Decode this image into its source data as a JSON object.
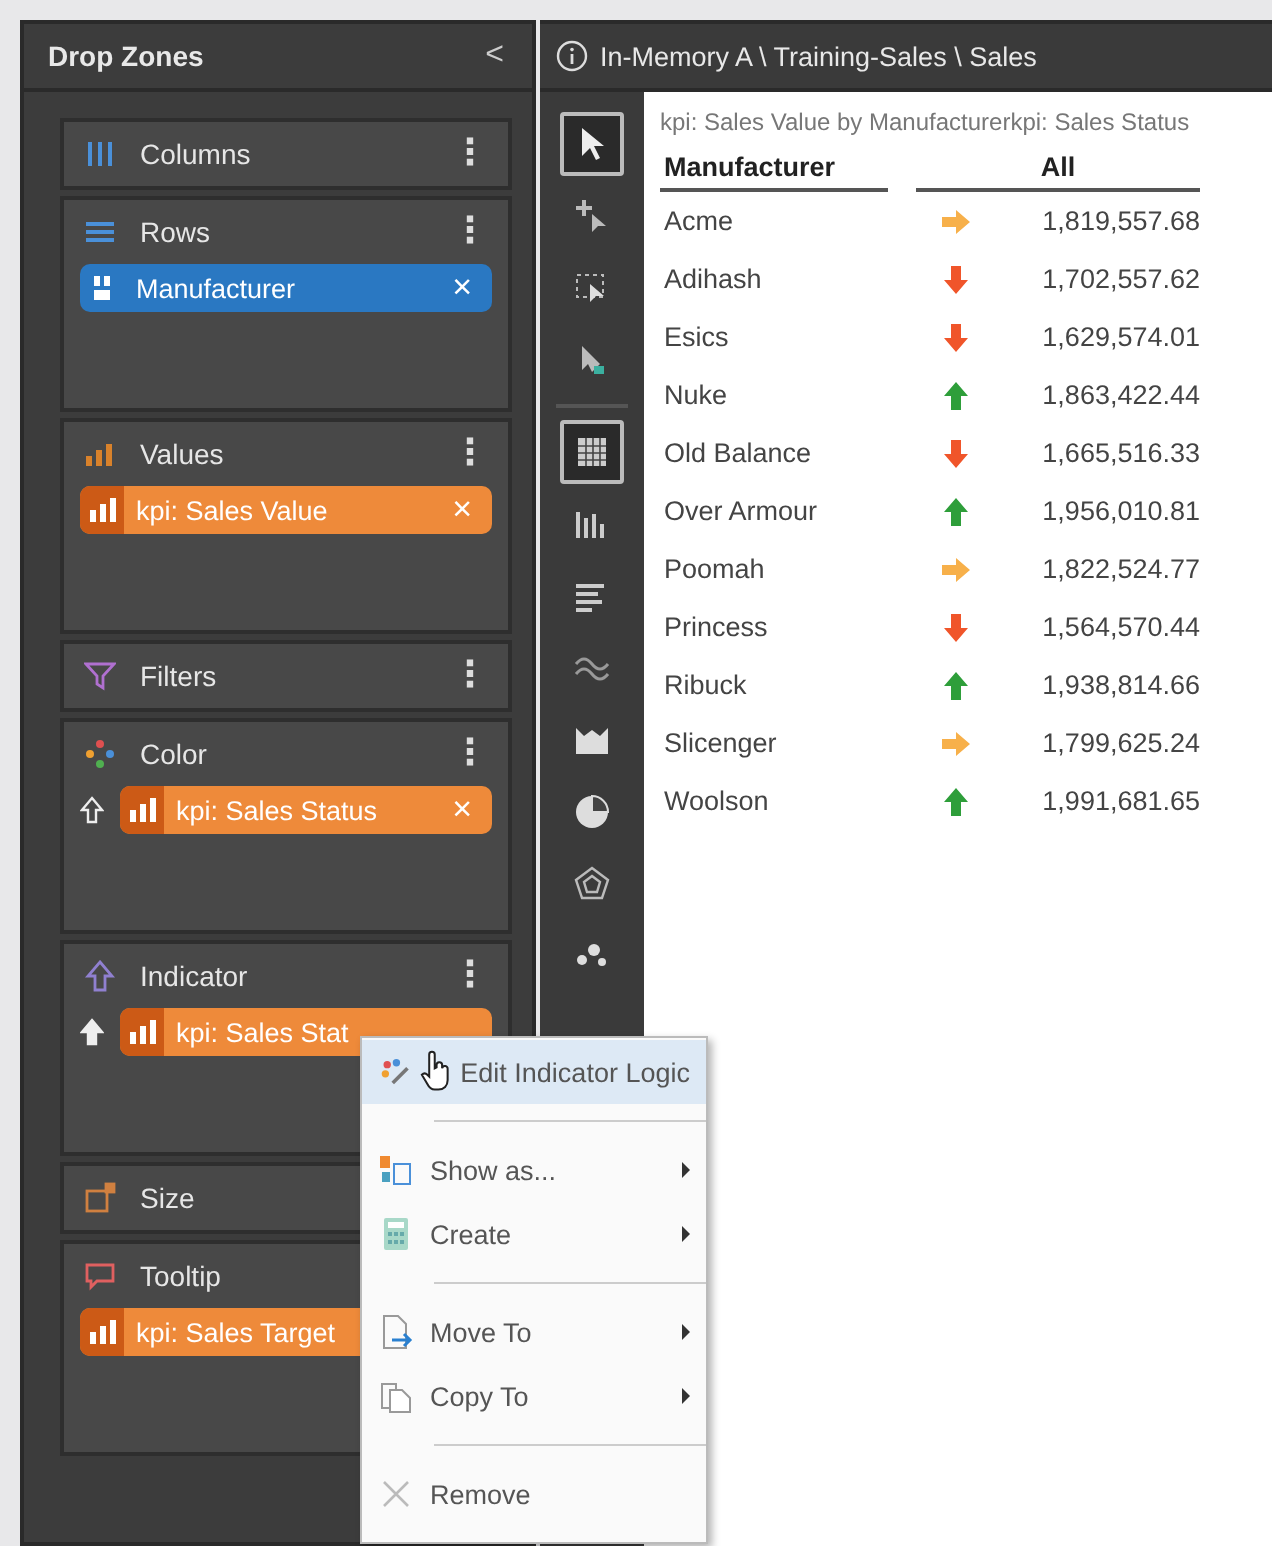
{
  "drop_panel": {
    "title": "Drop Zones",
    "collapse": "<",
    "zones": [
      {
        "label": "Columns",
        "kind": "columns",
        "more": "⋮"
      },
      {
        "label": "Rows",
        "kind": "rows",
        "more": "⋮",
        "chips": [
          {
            "label": "Manufacturer",
            "kind": "dimension",
            "remove": "×"
          }
        ]
      },
      {
        "label": "Values",
        "kind": "values",
        "more": "⋮",
        "chips": [
          {
            "label": "kpi: Sales Value",
            "kind": "measure",
            "remove": "×"
          }
        ]
      },
      {
        "label": "Filters",
        "kind": "filters",
        "more": "⋮"
      },
      {
        "label": "Color",
        "kind": "color",
        "more": "⋮",
        "chips": [
          {
            "label": "kpi: Sales Status",
            "kind": "measure",
            "up_arrow": true,
            "arrow_filled": false,
            "remove": "×"
          }
        ]
      },
      {
        "label": "Indicator",
        "kind": "indicator",
        "more": "⋮",
        "chips": [
          {
            "label": "kpi: Sales Stat",
            "kind": "measure",
            "up_arrow": true,
            "arrow_filled": true
          }
        ]
      },
      {
        "label": "Size",
        "kind": "size"
      },
      {
        "label": "Tooltip",
        "kind": "tooltip",
        "chips": [
          {
            "label": "kpi: Sales Target",
            "kind": "measure"
          }
        ]
      }
    ]
  },
  "breadcrumb": "In-Memory A \\ Training-Sales \\ Sales",
  "toolbar": [
    {
      "kind": "pointer",
      "selected": true
    },
    {
      "kind": "add-pointer",
      "selected": false
    },
    {
      "kind": "select-area",
      "selected": false
    },
    {
      "kind": "pointer-badge",
      "selected": false
    },
    {
      "kind": "grid",
      "selected": true,
      "separator_before": true
    },
    {
      "kind": "bars",
      "selected": false
    },
    {
      "kind": "lines",
      "selected": false
    },
    {
      "kind": "wave",
      "selected": false
    },
    {
      "kind": "area",
      "selected": false
    },
    {
      "kind": "pie",
      "selected": false
    },
    {
      "kind": "radar",
      "selected": false
    },
    {
      "kind": "scatter",
      "selected": false
    }
  ],
  "report": {
    "title": "kpi: Sales Value by Manufacturerkpi: Sales Status",
    "columns": [
      "Manufacturer",
      "All"
    ],
    "rows": [
      {
        "name": "Acme",
        "kind": "flat",
        "value": "1,819,557.68"
      },
      {
        "name": "Adihash",
        "kind": "down",
        "value": "1,702,557.62"
      },
      {
        "name": "Esics",
        "kind": "down",
        "value": "1,629,574.01"
      },
      {
        "name": "Nuke",
        "kind": "up",
        "value": "1,863,422.44"
      },
      {
        "name": "Old Balance",
        "kind": "down",
        "value": "1,665,516.33"
      },
      {
        "name": "Over Armour",
        "kind": "up",
        "value": "1,956,010.81"
      },
      {
        "name": "Poomah",
        "kind": "flat",
        "value": "1,822,524.77"
      },
      {
        "name": "Princess",
        "kind": "down",
        "value": "1,564,570.44"
      },
      {
        "name": "Ribuck",
        "kind": "up",
        "value": "1,938,814.66"
      },
      {
        "name": "Slicenger",
        "kind": "flat",
        "value": "1,799,625.24"
      },
      {
        "name": "Woolson",
        "kind": "up",
        "value": "1,991,681.65"
      }
    ]
  },
  "context_menu": {
    "items": [
      {
        "label": "Edit Indicator Logic",
        "kind": "logic",
        "highlighted": true,
        "submenu": false
      },
      {
        "label": "Show as...",
        "kind": "show",
        "highlighted": false,
        "submenu": true,
        "separator_before": true
      },
      {
        "label": "Create",
        "kind": "calc",
        "highlighted": false,
        "submenu": true
      },
      {
        "label": "Move To",
        "kind": "move",
        "highlighted": false,
        "submenu": true,
        "separator_before": true
      },
      {
        "label": "Copy To",
        "kind": "copy",
        "highlighted": false,
        "submenu": true
      },
      {
        "label": "Remove",
        "kind": "remove",
        "highlighted": false,
        "submenu": false,
        "separator_before": true
      }
    ]
  }
}
